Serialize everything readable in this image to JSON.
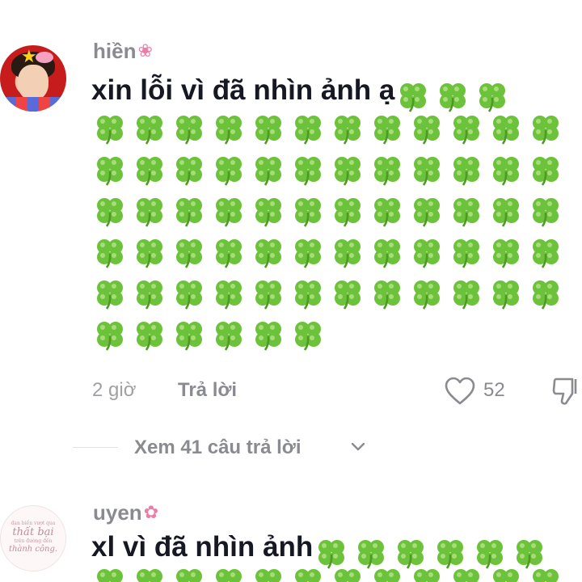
{
  "comments": [
    {
      "username": "hiền",
      "username_emoji": "tulip-icon",
      "text": "xin lỗi vì đã nhìn ảnh ạ",
      "inline_clovers": 3,
      "grid_rows": [
        12,
        12,
        12,
        12,
        12,
        6
      ],
      "time": "2 giờ",
      "reply_label": "Trả lời",
      "like_count": "52",
      "view_replies": "Xem 41 câu trả lời"
    },
    {
      "username": "uyen",
      "username_emoji": "lotus-icon",
      "text": "xl vì đã nhìn ảnh",
      "inline_clovers": 6,
      "avatar_text": {
        "line1": "đạn biến vượt qua",
        "line2": "thất bại",
        "line3": "trên đường đến",
        "line4": "thành công."
      }
    }
  ],
  "icons": {
    "clover": "four-leaf-clover-icon",
    "like": "heart-icon",
    "dislike": "thumbs-down-icon",
    "expand": "chevron-down-icon"
  },
  "colors": {
    "text_primary": "#161823",
    "text_secondary": "#8a8b91",
    "clover_green": "#6cc23a"
  }
}
